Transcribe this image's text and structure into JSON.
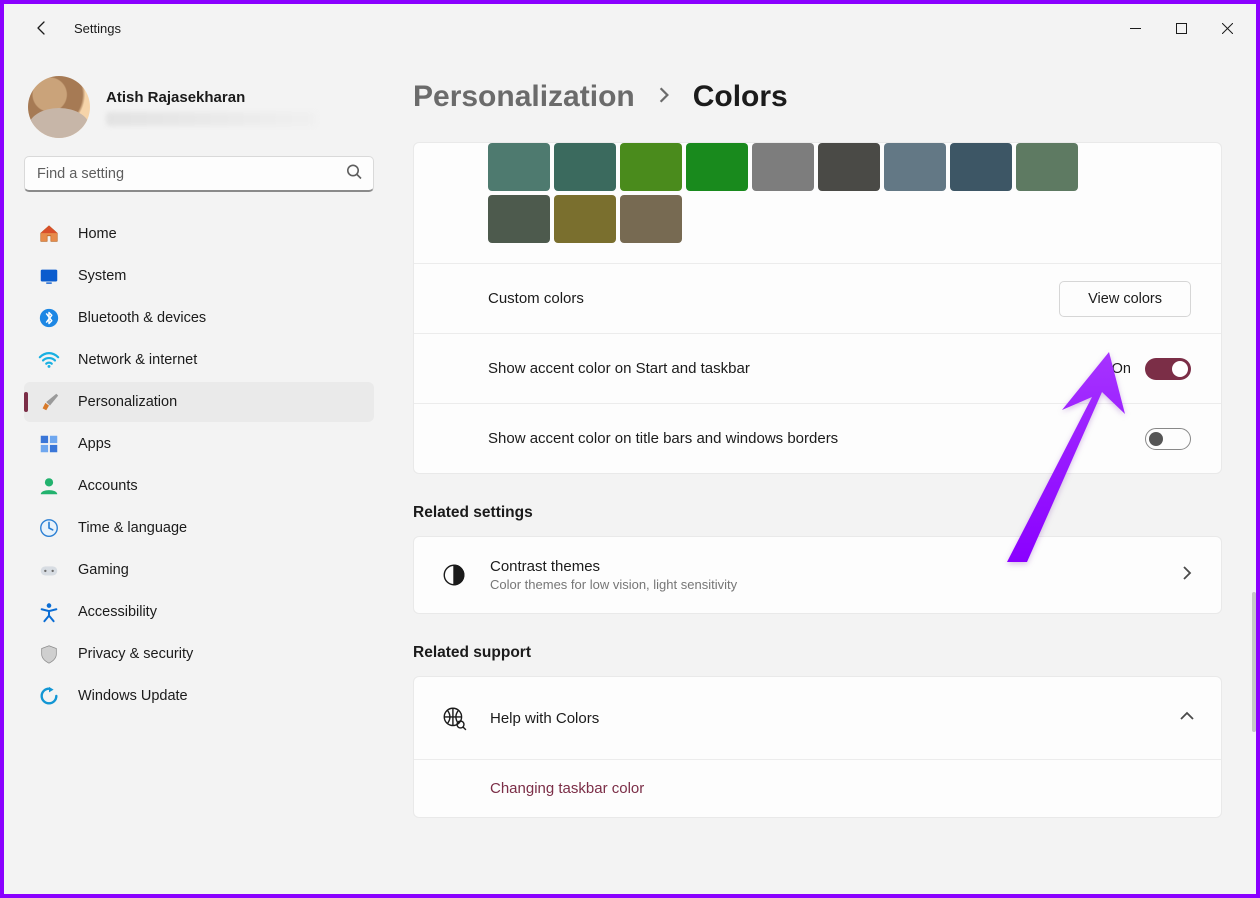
{
  "titlebar": {
    "title": "Settings"
  },
  "profile": {
    "name": "Atish Rajasekharan"
  },
  "search": {
    "placeholder": "Find a setting"
  },
  "nav": {
    "items": [
      {
        "label": "Home"
      },
      {
        "label": "System"
      },
      {
        "label": "Bluetooth & devices"
      },
      {
        "label": "Network & internet"
      },
      {
        "label": "Personalization",
        "active": true
      },
      {
        "label": "Apps"
      },
      {
        "label": "Accounts"
      },
      {
        "label": "Time & language"
      },
      {
        "label": "Gaming"
      },
      {
        "label": "Accessibility"
      },
      {
        "label": "Privacy & security"
      },
      {
        "label": "Windows Update"
      }
    ]
  },
  "breadcrumb": {
    "parent": "Personalization",
    "current": "Colors"
  },
  "swatches": {
    "row1": [
      "#4e7a6f",
      "#3b6a5e",
      "#4a8b1c",
      "#198a1d",
      "#7d7d7d",
      "#4a4a46",
      "#637885",
      "#3d5665",
      "#5e7a62"
    ],
    "row2": [
      "#4d5a4d",
      "#7a6f2e",
      "#776a52"
    ]
  },
  "custom_colors": {
    "label": "Custom colors",
    "button": "View colors"
  },
  "accent_start": {
    "label": "Show accent color on Start and taskbar",
    "state": "On",
    "on": true
  },
  "accent_title": {
    "label": "Show accent color on title bars and windows borders",
    "on": false
  },
  "related_settings": {
    "heading": "Related settings",
    "contrast": {
      "title": "Contrast themes",
      "sub": "Color themes for low vision, light sensitivity"
    }
  },
  "related_support": {
    "heading": "Related support",
    "help": {
      "title": "Help with Colors",
      "link": "Changing taskbar color"
    }
  }
}
